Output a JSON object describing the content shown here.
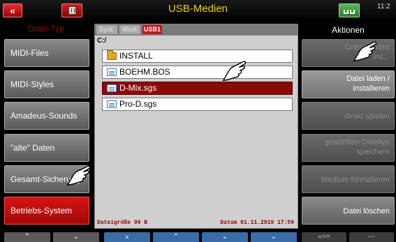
{
  "header": {
    "back_glyph": "«",
    "title": "USB-Medien",
    "clock": "11:2"
  },
  "left": {
    "header": "Datei-Typ",
    "buttons": [
      {
        "label": "MIDI-Files"
      },
      {
        "label": "MIDI-Styles"
      },
      {
        "label": "Amadeus-Sounds"
      },
      {
        "label": "\"alte\" Daten"
      },
      {
        "label": "Gesamt-Sicherung"
      },
      {
        "label": "Betriebs-System"
      }
    ]
  },
  "center": {
    "tabs": [
      "Syst.",
      "Work",
      "USB1"
    ],
    "active_tab": "USB1",
    "path": "C:/",
    "files": [
      {
        "name": "INSTALL",
        "type": "folder"
      },
      {
        "name": "BOEHM.BOS",
        "type": "file"
      },
      {
        "name": "D-Mix.sgs",
        "type": "file",
        "selected": true
      },
      {
        "name": "Pro-D.sgs",
        "type": "file"
      }
    ],
    "status": {
      "size": "Dateigröße  99 B",
      "date": "Datum  01.11.2019  17:59"
    }
  },
  "right": {
    "header": "Aktionen",
    "buttons": [
      {
        "line1": "Ordner laden",
        "line2": "ins..."
      },
      {
        "line1": "Datei laden /",
        "line2": "installieren"
      },
      {
        "line1": "direkt spielen",
        "line2": ""
      },
      {
        "line1": "gewählten Dateityp",
        "line2": "speichern"
      },
      {
        "line1": "Medium formatieren",
        "line2": ""
      },
      {
        "line1": "Datei löschen",
        "line2": ""
      }
    ]
  },
  "bottom": {
    "buttons": [
      "⌃",
      "⌄",
      "⌅",
      "⌃",
      "⌄",
      "⌄",
      "«==",
      "---"
    ]
  },
  "colors": {
    "accent_red": "#c21717",
    "title_yellow": "#f0d000",
    "selected_row": "#8a0a0a",
    "nav_blue": "#3a6ca8"
  }
}
